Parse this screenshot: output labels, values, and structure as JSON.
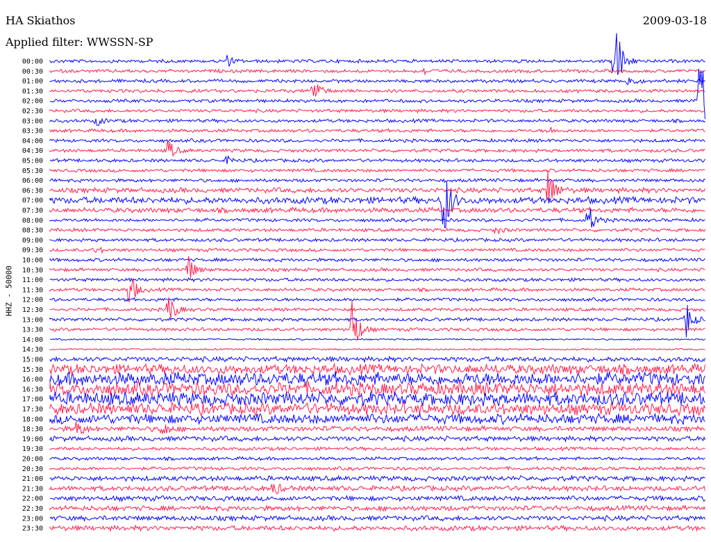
{
  "header": {
    "station": "HA Skiathos",
    "date": "2009-03-18",
    "filter_label": "Applied filter: WWSSN-SP"
  },
  "chart_data": {
    "type": "line",
    "title": "HA Skiathos",
    "subtitle": "Applied filter: WWSSN-SP",
    "ylabel": "HHZ - 50000",
    "colors": [
      "#0000ff",
      "#ff1a4a"
    ],
    "rows": [
      "00:00",
      "00:30",
      "01:00",
      "01:30",
      "02:00",
      "02:30",
      "03:00",
      "03:30",
      "04:00",
      "04:30",
      "05:00",
      "05:30",
      "06:00",
      "06:30",
      "07:00",
      "07:30",
      "08:00",
      "08:30",
      "09:00",
      "09:30",
      "10:00",
      "10:30",
      "11:00",
      "11:30",
      "12:00",
      "12:30",
      "13:00",
      "13:30",
      "14:00",
      "14:30",
      "15:00",
      "15:30",
      "16:00",
      "16:30",
      "17:00",
      "17:30",
      "18:00",
      "18:30",
      "19:00",
      "19:30",
      "20:00",
      "20:30",
      "21:00",
      "21:30",
      "22:00",
      "22:30",
      "23:00",
      "23:30"
    ],
    "noise_level": [
      2,
      2,
      2,
      2,
      2,
      2,
      2,
      2,
      2,
      2,
      2,
      2,
      2,
      3,
      4,
      3,
      2,
      2,
      2,
      2,
      2,
      2,
      2,
      2,
      2,
      2,
      2,
      2,
      1,
      1,
      3,
      6,
      8,
      8,
      8,
      7,
      6,
      3,
      3,
      2,
      2,
      2,
      3,
      3,
      3,
      3,
      3,
      3
    ],
    "events": [
      {
        "row": 0,
        "t": 0.27,
        "amp": 8
      },
      {
        "row": 0,
        "t": 0.86,
        "amp": 90
      },
      {
        "row": 1,
        "t": 0.57,
        "amp": 5
      },
      {
        "row": 2,
        "t": 0.88,
        "amp": 12
      },
      {
        "row": 3,
        "t": 0.4,
        "amp": 28
      },
      {
        "row": 4,
        "t": 0.99,
        "amp": 90
      },
      {
        "row": 6,
        "t": 0.07,
        "amp": 8
      },
      {
        "row": 7,
        "t": 0.76,
        "amp": 6
      },
      {
        "row": 9,
        "t": 0.18,
        "amp": 18
      },
      {
        "row": 10,
        "t": 0.27,
        "amp": 7
      },
      {
        "row": 13,
        "t": 0.76,
        "amp": 42
      },
      {
        "row": 14,
        "t": 0.6,
        "amp": 75
      },
      {
        "row": 16,
        "t": 0.82,
        "amp": 28
      },
      {
        "row": 17,
        "t": 0.68,
        "amp": 6
      },
      {
        "row": 19,
        "t": 0.07,
        "amp": 5
      },
      {
        "row": 21,
        "t": 0.21,
        "amp": 25
      },
      {
        "row": 23,
        "t": 0.12,
        "amp": 35
      },
      {
        "row": 25,
        "t": 0.18,
        "amp": 30
      },
      {
        "row": 27,
        "t": 0.46,
        "amp": 55
      },
      {
        "row": 26,
        "t": 0.97,
        "amp": 30
      },
      {
        "row": 37,
        "t": 0.04,
        "amp": 14
      },
      {
        "row": 37,
        "t": 0.17,
        "amp": 14
      },
      {
        "row": 43,
        "t": 0.34,
        "amp": 12
      }
    ]
  }
}
